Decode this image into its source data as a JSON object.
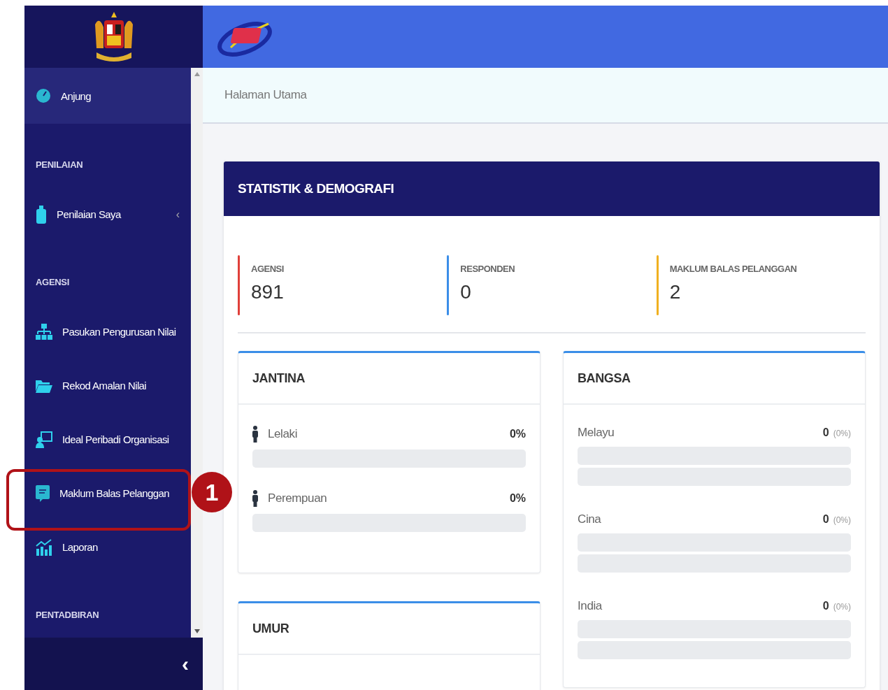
{
  "sidebar": {
    "items": [
      {
        "kind": "item",
        "label": "Anjung",
        "selected": true,
        "highlighted": false
      },
      {
        "kind": "section",
        "label": "PENILAIAN"
      },
      {
        "kind": "item",
        "label": "Penilaian Saya",
        "selected": false,
        "highlighted": false,
        "caret": "‹"
      },
      {
        "kind": "section",
        "label": "AGENSI"
      },
      {
        "kind": "item",
        "label": "Pasukan Pengurusan Nilai",
        "selected": false,
        "highlighted": false
      },
      {
        "kind": "item",
        "label": "Rekod Amalan Nilai",
        "selected": false,
        "highlighted": false
      },
      {
        "kind": "item",
        "label": "Ideal Peribadi Organisasi",
        "selected": false,
        "highlighted": false
      },
      {
        "kind": "item",
        "label": "Maklum Balas Pelanggan",
        "selected": false,
        "highlighted": true,
        "callout": "1"
      },
      {
        "kind": "item",
        "label": "Laporan",
        "selected": false,
        "highlighted": false
      },
      {
        "kind": "section",
        "label": "PENTADBIRAN"
      }
    ],
    "collapse": "‹"
  },
  "breadcrumb": "Halaman Utama",
  "card": {
    "title": "STATISTIK & DEMOGRAFI",
    "stats": [
      {
        "label": "AGENSI",
        "value": "891",
        "color": "#e0403a"
      },
      {
        "label": "RESPONDEN",
        "value": "0",
        "color": "#3b8ee8"
      },
      {
        "label": "MAKLUM BALAS PELANGGAN",
        "value": "2",
        "color": "#f0b020"
      }
    ],
    "jantina": {
      "title": "JANTINA",
      "rows": [
        {
          "label": "Lelaki",
          "value": "0%"
        },
        {
          "label": "Perempuan",
          "value": "0%"
        }
      ]
    },
    "umur": {
      "title": "UMUR"
    },
    "bangsa": {
      "title": "BANGSA",
      "rows": [
        {
          "label": "Melayu",
          "count": "0",
          "percent": "(0%)"
        },
        {
          "label": "Cina",
          "count": "0",
          "percent": "(0%)"
        },
        {
          "label": "India",
          "count": "0",
          "percent": "(0%)"
        }
      ]
    }
  }
}
